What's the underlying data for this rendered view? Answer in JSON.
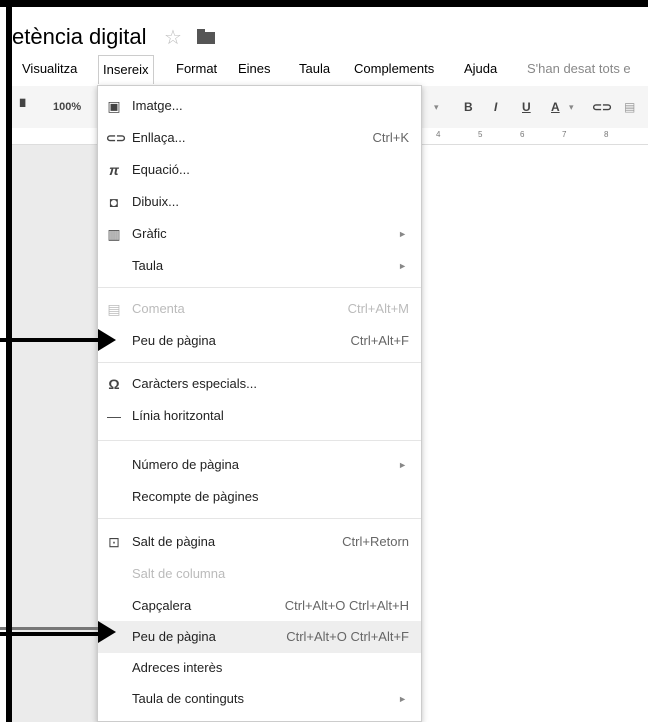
{
  "document": {
    "title": "etència digital"
  },
  "menubar": {
    "items": [
      "Visualitza",
      "Insereix",
      "Format",
      "Eines",
      "Taula",
      "Complements",
      "Ajuda"
    ],
    "active": "Insereix",
    "save_status": "S'han desat tots e"
  },
  "toolbar": {
    "zoom": "100%",
    "bold": "B",
    "italic": "I",
    "underline": "U",
    "text_color": "A",
    "dropdown_caret": "▾"
  },
  "ruler": {
    "marks": [
      "4",
      "5",
      "6",
      "7",
      "8"
    ]
  },
  "insert_menu": {
    "items": [
      {
        "label": "Imatge...",
        "icon": "image-icon"
      },
      {
        "label": "Enllaça...",
        "icon": "link-icon",
        "shortcut": "Ctrl+K"
      },
      {
        "label": "Equació...",
        "icon": "pi-icon"
      },
      {
        "label": "Dibuix...",
        "icon": "drawing-icon"
      },
      {
        "label": "Gràfic",
        "icon": "chart-icon",
        "submenu": true
      },
      {
        "label": "Taula",
        "submenu": true
      },
      {
        "label": "Comenta",
        "icon": "comment-icon",
        "shortcut": "Ctrl+Alt+M",
        "disabled": true
      },
      {
        "label": "Peu de pàgina",
        "shortcut": "Ctrl+Alt+F"
      },
      {
        "label": "Caràcters especials...",
        "icon": "omega-icon"
      },
      {
        "label": "Línia horitzontal",
        "icon": "horizontal-line-icon"
      },
      {
        "label": "Número de pàgina",
        "submenu": true
      },
      {
        "label": "Recompte de pàgines"
      },
      {
        "label": "Salt de pàgina",
        "icon": "page-break-icon",
        "shortcut": "Ctrl+Retorn"
      },
      {
        "label": "Salt de columna",
        "disabled": true
      },
      {
        "label": "Capçalera",
        "shortcut": "Ctrl+Alt+O Ctrl+Alt+H"
      },
      {
        "label": "Peu de pàgina",
        "shortcut": "Ctrl+Alt+O Ctrl+Alt+F",
        "highlighted": true
      },
      {
        "label": "Adreces interès"
      },
      {
        "label": "Taula de continguts",
        "submenu": true
      }
    ]
  },
  "colors": {
    "frame": "#000000",
    "highlight": "#eeeeee",
    "disabled": "#bbbbbb"
  }
}
